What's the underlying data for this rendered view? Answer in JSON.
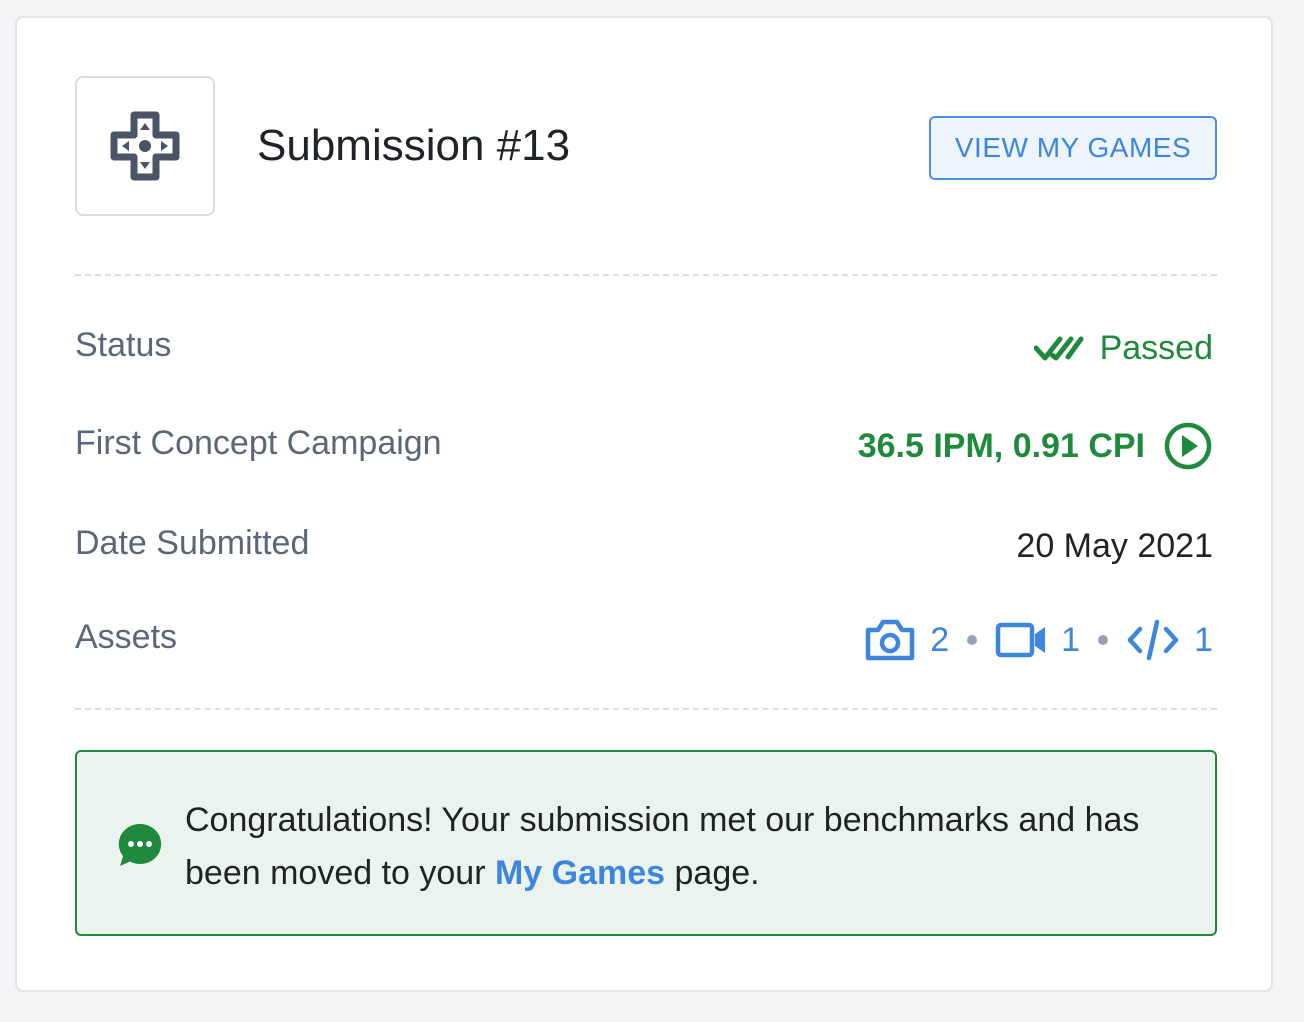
{
  "submission": {
    "title": "Submission #13",
    "view_button_label": "VIEW MY GAMES"
  },
  "details": {
    "status": {
      "label": "Status",
      "value": "Passed"
    },
    "campaign": {
      "label": "First Concept Campaign",
      "value": "36.5 IPM, 0.91 CPI"
    },
    "date": {
      "label": "Date Submitted",
      "value": "20 May 2021"
    },
    "assets": {
      "label": "Assets",
      "images": "2",
      "videos": "1",
      "code": "1"
    }
  },
  "notice": {
    "text_before": "Congratulations! Your submission met our benchmarks and has been moved to your ",
    "link": "My Games",
    "text_after": " page."
  },
  "colors": {
    "success": "#1f8a3b",
    "link": "#3d86dd",
    "icon": "#4a5466"
  },
  "icons": {
    "game": "gamepad-dpad-icon",
    "status": "double-check-icon",
    "campaign": "play-circle-icon",
    "images": "camera-icon",
    "videos": "video-camera-icon",
    "code": "code-icon",
    "notice": "chat-bubble-icon"
  }
}
